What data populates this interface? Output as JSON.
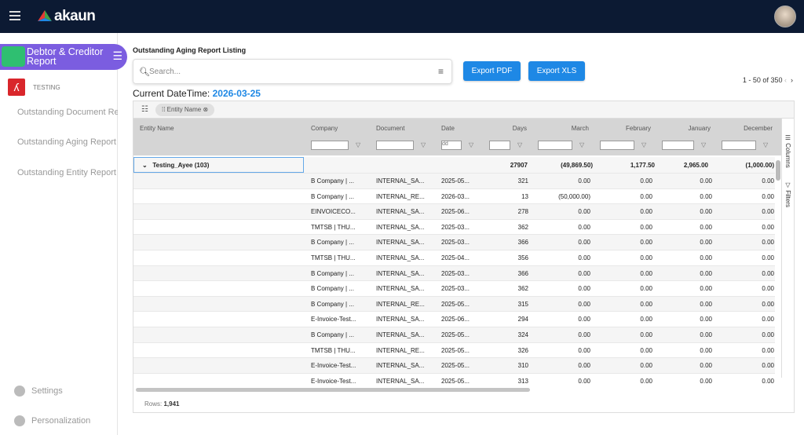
{
  "header": {
    "logo": "akaun"
  },
  "sidebar": {
    "app_title": "Debtor & Creditor Report",
    "section": "TESTING",
    "items": [
      "Outstanding Document Report",
      "Outstanding Aging Report",
      "Outstanding Entity Report"
    ],
    "settings": "Settings",
    "personalization": "Personalization"
  },
  "main": {
    "title": "Outstanding Aging Report Listing",
    "search_placeholder": "Search...",
    "export_pdf": "Export PDF",
    "export_xls": "Export XLS",
    "pager": "1 - 50 of 350",
    "current_label": "Current DateTime:",
    "current_value": "2026-03-25"
  },
  "grid": {
    "group_chip": "Entity Name",
    "columns": [
      "Entity Name",
      "Company",
      "Document",
      "Date",
      "Days",
      "March",
      "February",
      "January",
      "December"
    ],
    "date_placeholder": "dd",
    "group_row": {
      "label": "Testing_Ayee (103)",
      "days": "27907",
      "march": "(49,869.50)",
      "february": "1,177.50",
      "january": "2,965.00",
      "december": "(1,000.00)"
    },
    "rows": [
      [
        "B Company | ...",
        "INTERNAL_SA...",
        "2025-05...",
        "321",
        "0.00",
        "0.00",
        "0.00",
        "0.00"
      ],
      [
        "B Company | ...",
        "INTERNAL_RE...",
        "2026-03...",
        "13",
        "(50,000.00)",
        "0.00",
        "0.00",
        "0.00"
      ],
      [
        "EINVOICECO...",
        "INTERNAL_SA...",
        "2025-06...",
        "278",
        "0.00",
        "0.00",
        "0.00",
        "0.00"
      ],
      [
        "TMTSB | THU...",
        "INTERNAL_SA...",
        "2025-03...",
        "362",
        "0.00",
        "0.00",
        "0.00",
        "0.00"
      ],
      [
        "B Company | ...",
        "INTERNAL_SA...",
        "2025-03...",
        "366",
        "0.00",
        "0.00",
        "0.00",
        "0.00"
      ],
      [
        "TMTSB | THU...",
        "INTERNAL_SA...",
        "2025-04...",
        "356",
        "0.00",
        "0.00",
        "0.00",
        "0.00"
      ],
      [
        "B Company | ...",
        "INTERNAL_SA...",
        "2025-03...",
        "366",
        "0.00",
        "0.00",
        "0.00",
        "0.00"
      ],
      [
        "B Company | ...",
        "INTERNAL_SA...",
        "2025-03...",
        "362",
        "0.00",
        "0.00",
        "0.00",
        "0.00"
      ],
      [
        "B Company | ...",
        "INTERNAL_RE...",
        "2025-05...",
        "315",
        "0.00",
        "0.00",
        "0.00",
        "0.00"
      ],
      [
        "E-Invoice-Test...",
        "INTERNAL_SA...",
        "2025-06...",
        "294",
        "0.00",
        "0.00",
        "0.00",
        "0.00"
      ],
      [
        "B Company | ...",
        "INTERNAL_SA...",
        "2025-05...",
        "324",
        "0.00",
        "0.00",
        "0.00",
        "0.00"
      ],
      [
        "TMTSB | THU...",
        "INTERNAL_RE...",
        "2025-05...",
        "326",
        "0.00",
        "0.00",
        "0.00",
        "0.00"
      ],
      [
        "E-Invoice-Test...",
        "INTERNAL_SA...",
        "2025-05...",
        "310",
        "0.00",
        "0.00",
        "0.00",
        "0.00"
      ],
      [
        "E-Invoice-Test...",
        "INTERNAL_SA...",
        "2025-05...",
        "313",
        "0.00",
        "0.00",
        "0.00",
        "0.00"
      ]
    ],
    "side_columns": "Columns",
    "side_filters": "Filters",
    "rows_label": "Rows:",
    "rows_count": "1,941"
  },
  "colors": {
    "accent": "#1e88e5",
    "topbar": "#0c1a33",
    "app_pill": "#7b5de0"
  }
}
